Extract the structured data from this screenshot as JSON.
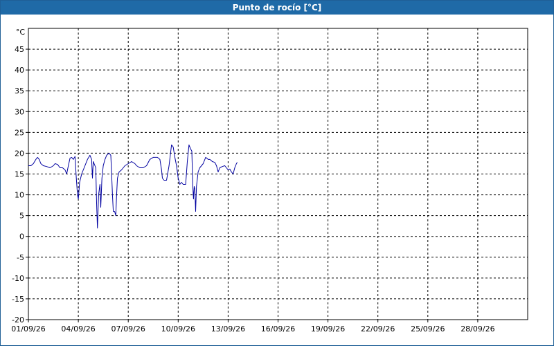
{
  "window": {
    "title": "Punto de rocío [°C]"
  },
  "chart_data": {
    "type": "line",
    "title": "Punto de rocío [°C]",
    "ylabel": "°C",
    "xlabel": "",
    "xlim": [
      1,
      31
    ],
    "ylim": [
      -20,
      50
    ],
    "grid": true,
    "legend": "none",
    "y_ticks": [
      -20,
      -15,
      -10,
      -5,
      0,
      5,
      10,
      15,
      20,
      25,
      30,
      35,
      40,
      45
    ],
    "x_ticks": [
      {
        "day": 1,
        "label": "01/09/26"
      },
      {
        "day": 4,
        "label": "04/09/26"
      },
      {
        "day": 7,
        "label": "07/09/26"
      },
      {
        "day": 10,
        "label": "10/09/26"
      },
      {
        "day": 13,
        "label": "13/09/26"
      },
      {
        "day": 16,
        "label": "16/09/26"
      },
      {
        "day": 19,
        "label": "19/09/26"
      },
      {
        "day": 22,
        "label": "22/09/26"
      },
      {
        "day": 25,
        "label": "25/09/26"
      },
      {
        "day": 28,
        "label": "28/09/26"
      }
    ],
    "series": [
      {
        "color": "#0000a0",
        "points": [
          [
            1.0,
            17.0
          ],
          [
            1.15,
            17.0
          ],
          [
            1.3,
            17.5
          ],
          [
            1.45,
            18.5
          ],
          [
            1.55,
            19.0
          ],
          [
            1.65,
            18.5
          ],
          [
            1.75,
            17.5
          ],
          [
            1.9,
            17.0
          ],
          [
            2.1,
            16.8
          ],
          [
            2.3,
            16.5
          ],
          [
            2.5,
            17.0
          ],
          [
            2.6,
            17.5
          ],
          [
            2.75,
            17.3
          ],
          [
            2.9,
            16.5
          ],
          [
            3.05,
            16.5
          ],
          [
            3.2,
            16.0
          ],
          [
            3.3,
            15.0
          ],
          [
            3.4,
            17.0
          ],
          [
            3.5,
            18.8
          ],
          [
            3.6,
            19.0
          ],
          [
            3.7,
            18.5
          ],
          [
            3.8,
            19.2
          ],
          [
            3.88,
            14.0
          ],
          [
            3.95,
            10.0
          ],
          [
            4.0,
            9.0
          ],
          [
            4.08,
            13.0
          ],
          [
            4.2,
            15.0
          ],
          [
            4.4,
            17.0
          ],
          [
            4.55,
            18.5
          ],
          [
            4.7,
            19.5
          ],
          [
            4.8,
            18.5
          ],
          [
            4.85,
            14.0
          ],
          [
            4.9,
            18.0
          ],
          [
            5.0,
            17.0
          ],
          [
            5.05,
            16.5
          ],
          [
            5.1,
            8.0
          ],
          [
            5.15,
            2.0
          ],
          [
            5.22,
            10.0
          ],
          [
            5.3,
            12.5
          ],
          [
            5.35,
            7.0
          ],
          [
            5.42,
            14.0
          ],
          [
            5.5,
            17.0
          ],
          [
            5.6,
            18.5
          ],
          [
            5.7,
            19.5
          ],
          [
            5.85,
            20.0
          ],
          [
            5.95,
            19.5
          ],
          [
            6.0,
            15.0
          ],
          [
            6.05,
            10.0
          ],
          [
            6.1,
            6.0
          ],
          [
            6.18,
            6.0
          ],
          [
            6.25,
            5.0
          ],
          [
            6.3,
            10.0
          ],
          [
            6.35,
            14.0
          ],
          [
            6.45,
            15.5
          ],
          [
            6.6,
            16.0
          ],
          [
            6.8,
            17.0
          ],
          [
            7.0,
            17.5
          ],
          [
            7.2,
            18.0
          ],
          [
            7.4,
            17.5
          ],
          [
            7.5,
            17.0
          ],
          [
            7.7,
            16.5
          ],
          [
            7.9,
            16.5
          ],
          [
            8.1,
            17.0
          ],
          [
            8.3,
            18.5
          ],
          [
            8.5,
            19.0
          ],
          [
            8.75,
            19.0
          ],
          [
            8.9,
            18.5
          ],
          [
            9.0,
            16.0
          ],
          [
            9.05,
            14.0
          ],
          [
            9.15,
            13.5
          ],
          [
            9.3,
            13.5
          ],
          [
            9.45,
            17.0
          ],
          [
            9.6,
            22.0
          ],
          [
            9.7,
            21.5
          ],
          [
            9.8,
            19.0
          ],
          [
            9.9,
            17.0
          ],
          [
            10.0,
            14.0
          ],
          [
            10.1,
            12.5
          ],
          [
            10.2,
            13.0
          ],
          [
            10.3,
            12.5
          ],
          [
            10.45,
            12.5
          ],
          [
            10.55,
            18.0
          ],
          [
            10.65,
            22.0
          ],
          [
            10.75,
            21.0
          ],
          [
            10.82,
            20.5
          ],
          [
            10.88,
            12.0
          ],
          [
            10.92,
            9.0
          ],
          [
            10.96,
            12.0
          ],
          [
            11.0,
            11.5
          ],
          [
            11.05,
            6.0
          ],
          [
            11.1,
            12.0
          ],
          [
            11.2,
            15.5
          ],
          [
            11.3,
            16.5
          ],
          [
            11.5,
            17.5
          ],
          [
            11.65,
            19.0
          ],
          [
            11.8,
            18.5
          ],
          [
            11.9,
            18.5
          ],
          [
            12.05,
            18.0
          ],
          [
            12.2,
            17.8
          ],
          [
            12.3,
            17.0
          ],
          [
            12.4,
            15.5
          ],
          [
            12.5,
            16.5
          ],
          [
            12.65,
            16.8
          ],
          [
            12.8,
            17.0
          ],
          [
            12.9,
            16.5
          ],
          [
            13.0,
            16.0
          ],
          [
            13.1,
            16.2
          ],
          [
            13.2,
            15.5
          ],
          [
            13.3,
            15.0
          ],
          [
            13.4,
            16.5
          ],
          [
            13.5,
            17.5
          ],
          [
            13.55,
            17.8
          ]
        ]
      }
    ]
  }
}
